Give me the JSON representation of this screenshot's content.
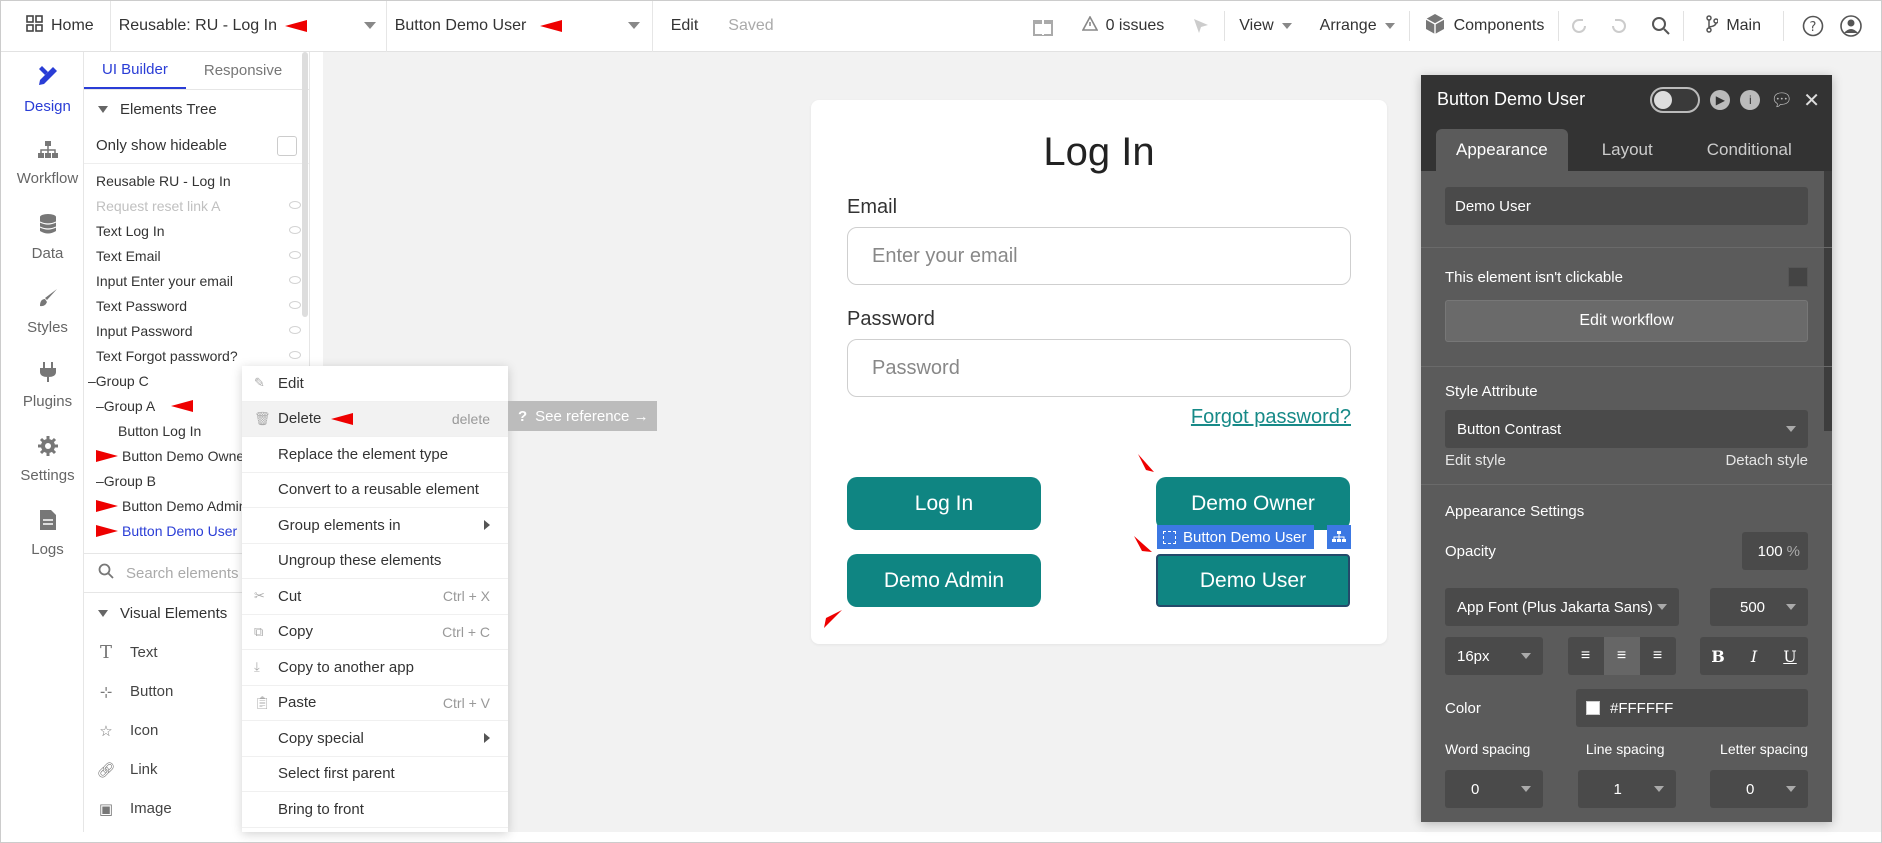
{
  "topbar": {
    "home_label": "Home",
    "page_selector": "Reusable: RU - Log In",
    "element_selector": "Button Demo User",
    "edit_label": "Edit",
    "saved_label": "Saved",
    "issues_label": "0 issues",
    "view_label": "View",
    "arrange_label": "Arrange",
    "components_label": "Components",
    "branch_label": "Main"
  },
  "rail": {
    "items": [
      {
        "label": "Design",
        "icon": "design-icon"
      },
      {
        "label": "Workflow",
        "icon": "workflow-icon"
      },
      {
        "label": "Data",
        "icon": "database-icon"
      },
      {
        "label": "Styles",
        "icon": "brush-icon"
      },
      {
        "label": "Plugins",
        "icon": "plug-icon"
      },
      {
        "label": "Settings",
        "icon": "gear-icon"
      },
      {
        "label": "Logs",
        "icon": "document-icon"
      }
    ]
  },
  "left_panel": {
    "tabs": [
      "UI Builder",
      "Responsive"
    ],
    "tree_header": "Elements Tree",
    "only_hideable": "Only show hideable",
    "tree": [
      "Reusable RU - Log In",
      "Request reset link A",
      "Text Log In",
      "Text Email",
      "Input Enter your email",
      "Text Password",
      "Input Password",
      "Text Forgot password?",
      "Group C",
      "Group A",
      "Button Log In",
      "Button Demo Owner",
      "Group B",
      "Button Demo Admin",
      "Button Demo User"
    ],
    "search_placeholder": "Search elements",
    "visual_header": "Visual Elements",
    "visual": [
      "Text",
      "Button",
      "Icon",
      "Link",
      "Image"
    ]
  },
  "context_menu": {
    "items": [
      {
        "label": "Edit",
        "shortcut": ""
      },
      {
        "label": "Delete",
        "shortcut": "delete"
      },
      {
        "label": "Replace the element type",
        "shortcut": ""
      },
      {
        "label": "Convert to a reusable element",
        "shortcut": ""
      },
      {
        "label": "Group elements in",
        "shortcut": ""
      },
      {
        "label": "Ungroup these elements",
        "shortcut": ""
      },
      {
        "label": "Cut",
        "shortcut": "Ctrl + X"
      },
      {
        "label": "Copy",
        "shortcut": "Ctrl + C"
      },
      {
        "label": "Copy to another app",
        "shortcut": ""
      },
      {
        "label": "Paste",
        "shortcut": "Ctrl + V"
      },
      {
        "label": "Copy special",
        "shortcut": ""
      },
      {
        "label": "Select first parent",
        "shortcut": ""
      },
      {
        "label": "Bring to front",
        "shortcut": ""
      }
    ],
    "see_reference": "See reference →"
  },
  "canvas": {
    "title": "Log In",
    "email_label": "Email",
    "email_placeholder": "Enter your email",
    "password_label": "Password",
    "password_placeholder": "Password",
    "forgot": "Forgot password?",
    "btn_login": "Log In",
    "btn_owner": "Demo Owner",
    "btn_admin": "Demo Admin",
    "btn_user": "Demo User",
    "selection_label": "Button Demo User"
  },
  "props": {
    "title": "Button Demo User",
    "tabs": [
      "Appearance",
      "Layout",
      "Conditional"
    ],
    "text_value": "Demo User",
    "not_clickable": "This element isn't clickable",
    "edit_workflow": "Edit workflow",
    "style_attribute": "Style Attribute",
    "style_value": "Button Contrast",
    "edit_style": "Edit style",
    "detach_style": "Detach style",
    "appearance_settings": "Appearance Settings",
    "opacity_label": "Opacity",
    "opacity_value": "100",
    "opacity_unit": "%",
    "font": "App Font (Plus Jakarta Sans)",
    "weight": "500",
    "size": "16px",
    "color_label": "Color",
    "color_value": "#FFFFFF",
    "word_spacing": "Word spacing",
    "line_spacing": "Line spacing",
    "letter_spacing": "Letter spacing",
    "word_val": "0",
    "line_val": "1",
    "letter_val": "0"
  },
  "colors": {
    "accent": "#2a3dd6",
    "button": "#0f8582",
    "selection": "#3c78e3",
    "panel": "#5b5b5b",
    "annotation": "#e00000"
  }
}
